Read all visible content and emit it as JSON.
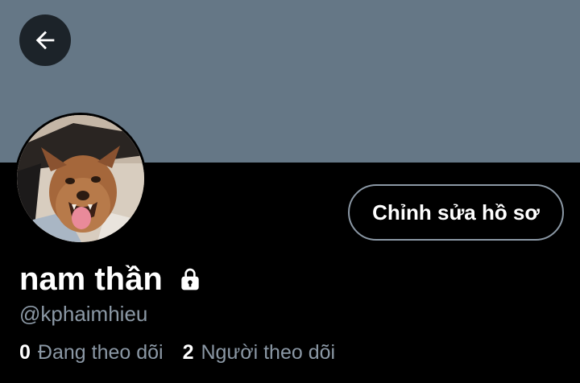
{
  "colors": {
    "background": "#000000",
    "banner": "#657786",
    "primary_text": "#ffffff",
    "secondary_text": "#8b98a5",
    "button_border": "#8b98a5"
  },
  "header": {
    "back_icon": "arrow-left-icon"
  },
  "profile": {
    "avatar_icon": "avatar-dog-photo",
    "edit_button_label": "Chỉnh sửa hồ sơ",
    "display_name": "nam thần",
    "protected_icon": "lock-icon",
    "handle": "@kphaimhieu",
    "following": {
      "count": "0",
      "label": "Đang theo dõi"
    },
    "followers": {
      "count": "2",
      "label": "Người theo dõi"
    }
  }
}
